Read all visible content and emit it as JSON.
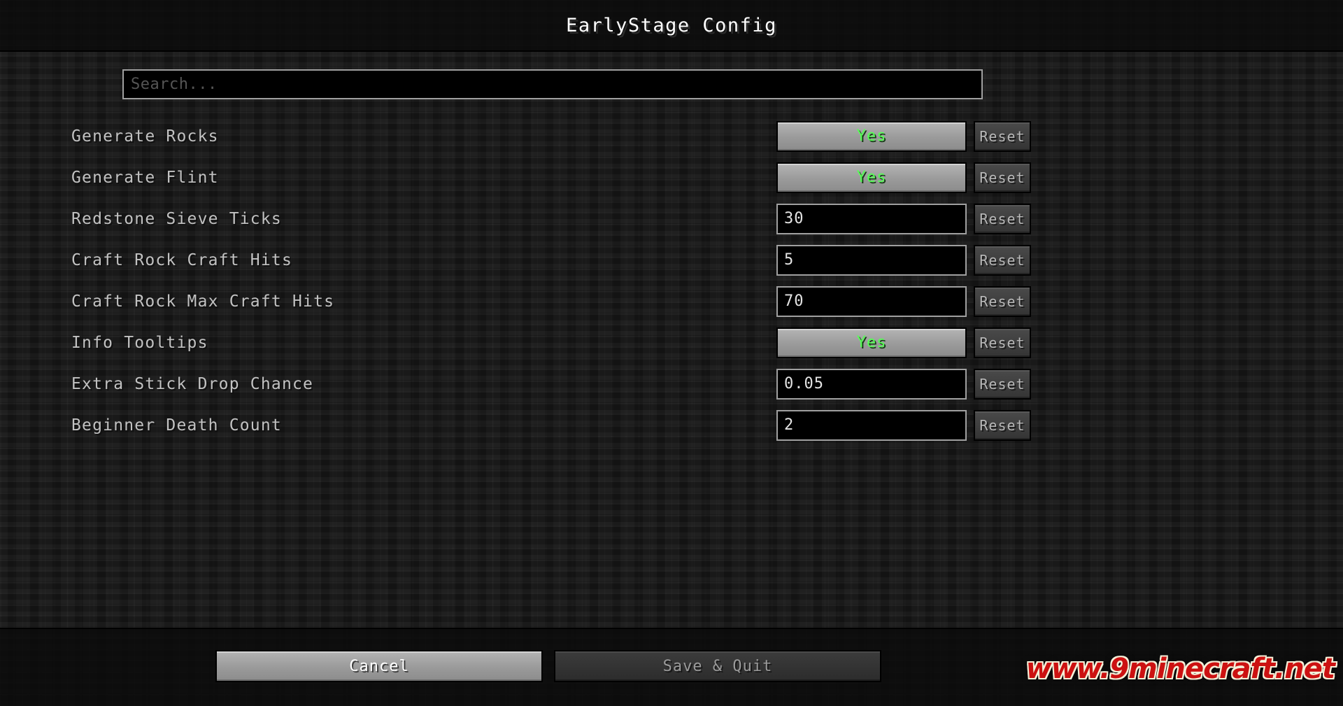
{
  "window": {
    "title": "EarlyStage Config"
  },
  "search": {
    "placeholder": "Search...",
    "value": ""
  },
  "options": [
    {
      "label": "Generate Rocks",
      "control_type": "toggle",
      "value": "Yes",
      "reset_label": "Reset"
    },
    {
      "label": "Generate Flint",
      "control_type": "toggle",
      "value": "Yes",
      "reset_label": "Reset"
    },
    {
      "label": "Redstone Sieve Ticks",
      "control_type": "text",
      "value": "30",
      "reset_label": "Reset"
    },
    {
      "label": "Craft Rock Craft Hits",
      "control_type": "text",
      "value": "5",
      "reset_label": "Reset"
    },
    {
      "label": "Craft Rock Max Craft Hits",
      "control_type": "text",
      "value": "70",
      "reset_label": "Reset"
    },
    {
      "label": "Info Tooltips",
      "control_type": "toggle",
      "value": "Yes",
      "reset_label": "Reset"
    },
    {
      "label": "Extra Stick Drop Chance",
      "control_type": "text",
      "value": "0.05",
      "reset_label": "Reset"
    },
    {
      "label": "Beginner Death Count",
      "control_type": "text",
      "value": "2",
      "reset_label": "Reset"
    }
  ],
  "footer": {
    "cancel_label": "Cancel",
    "save_label": "Save & Quit"
  },
  "watermark": {
    "text": "www.9minecraft.net"
  },
  "colors": {
    "toggle_yes": "#55ff55",
    "label": "#c2c2c2",
    "watermark_red": "#cc1111",
    "watermark_outline": "#f5efd8",
    "field_border": "#a0a0a0"
  }
}
